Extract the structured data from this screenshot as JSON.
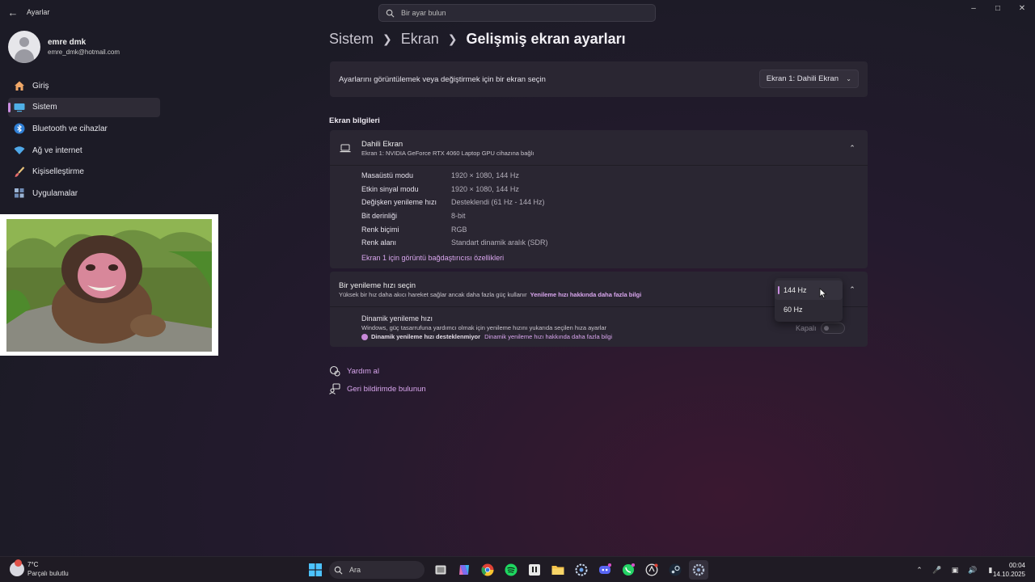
{
  "window": {
    "app_title": "Ayarlar",
    "search_placeholder": "Bir ayar bulun"
  },
  "profile": {
    "name": "emre dmk",
    "email": "emre_dmk@hotmail.com"
  },
  "sidebar": {
    "items": [
      {
        "label": "Giriş",
        "icon": "home-icon"
      },
      {
        "label": "Sistem",
        "icon": "system-icon",
        "active": true
      },
      {
        "label": "Bluetooth ve cihazlar",
        "icon": "bluetooth-icon"
      },
      {
        "label": "Ağ ve internet",
        "icon": "wifi-icon"
      },
      {
        "label": "Kişiselleştirme",
        "icon": "brush-icon"
      },
      {
        "label": "Uygulamalar",
        "icon": "apps-icon"
      }
    ]
  },
  "breadcrumb": {
    "items": [
      "Sistem",
      "Ekran"
    ],
    "current": "Gelişmiş ekran ayarları"
  },
  "display_select": {
    "label": "Ayarlarını görüntülemek veya değiştirmek için bir ekran seçin",
    "value": "Ekran 1: Dahili Ekran"
  },
  "display_info": {
    "section_title": "Ekran bilgileri",
    "title": "Dahili Ekran",
    "subtitle": "Ekran 1: NVIDIA GeForce RTX 4060 Laptop GPU cihazına bağlı",
    "rows": [
      {
        "label": "Masaüstü modu",
        "value": "1920 × 1080, 144 Hz"
      },
      {
        "label": "Etkin sinyal modu",
        "value": "1920 × 1080, 144 Hz"
      },
      {
        "label": "Değişken yenileme hızı",
        "value": "Desteklendi (61 Hz - 144 Hz)"
      },
      {
        "label": "Bit derinliği",
        "value": "8-bit"
      },
      {
        "label": "Renk biçimi",
        "value": "RGB"
      },
      {
        "label": "Renk alanı",
        "value": "Standart dinamik aralık (SDR)"
      }
    ],
    "adapter_link": "Ekran 1 için görüntü bağdaştırıcısı özellikleri"
  },
  "refresh": {
    "title": "Bir yenileme hızı seçin",
    "subtitle": "Yüksek bir hız daha akıcı hareket sağlar ancak daha fazla güç kullanır",
    "learn_more": "Yenileme hızı hakkında daha fazla bilgi",
    "options": [
      "144 Hz",
      "60 Hz"
    ],
    "selected": "144 Hz",
    "dynamic": {
      "title": "Dinamik yenileme hızı",
      "subtitle": "Windows, güç tasarrufuna yardımcı olmak için yenileme hızını yukarıda seçilen hıza ayarlar",
      "warning": "Dinamik yenileme hızı desteklenmiyor",
      "warning_link": "Dinamik yenileme hızı hakkında daha fazla bilgi",
      "toggle_label": "Kapalı"
    }
  },
  "help": {
    "get_help": "Yardım al",
    "feedback": "Geri bildirimde bulunun"
  },
  "taskbar": {
    "temperature": "7°C",
    "weather": "Parçalı bulutlu",
    "search": "Ara",
    "time": "00:04",
    "date": "14.10.2025"
  },
  "colors": {
    "accent": "#c98de0",
    "link": "#d9a6ee",
    "card": "#2a2632"
  }
}
